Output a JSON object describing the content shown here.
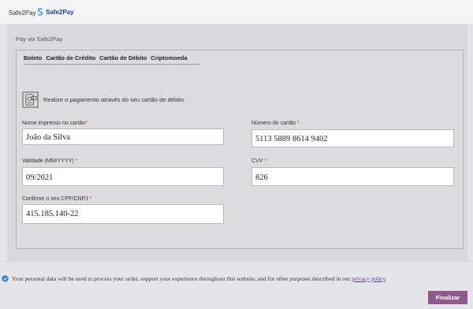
{
  "header": {
    "method_label": "Safe2Pay",
    "logo_text": "Safe2Pay"
  },
  "panel": {
    "title": "Pay via Safe2Pay"
  },
  "tabs": [
    {
      "label": "Boleto"
    },
    {
      "label": "Cartão de Crédito"
    },
    {
      "label": "Cartão de Débito"
    },
    {
      "label": "Criptomoeda"
    }
  ],
  "info": {
    "text": "Realize o pagamento através do seu cartão de débito.",
    "icon": "debit-card-icon"
  },
  "form": {
    "name_label": "Nome impresso no cartão",
    "name_value": "João da Silva",
    "card_number_label": "Número do cartão",
    "card_number_value": "5113 5889 8614 9402",
    "expiry_label": "Validade (MM/YYYY)",
    "expiry_value": "09/2021",
    "cvv_label": "CVV",
    "cvv_value": "826",
    "cpf_label": "Confirme o seu CPF/CNPJ",
    "cpf_value": "415.185.140-22",
    "required_mark": "*"
  },
  "footer": {
    "privacy_text": "Your personal data will be used to process your order, support your experience throughout this website, and for other purposes described in our",
    "privacy_link": "privacy policy",
    "privacy_end": ".",
    "finalize_label": "Finalizar"
  },
  "colors": {
    "accent": "#8e5a8f",
    "brand": "#1c3f8f",
    "required": "#d93025"
  }
}
